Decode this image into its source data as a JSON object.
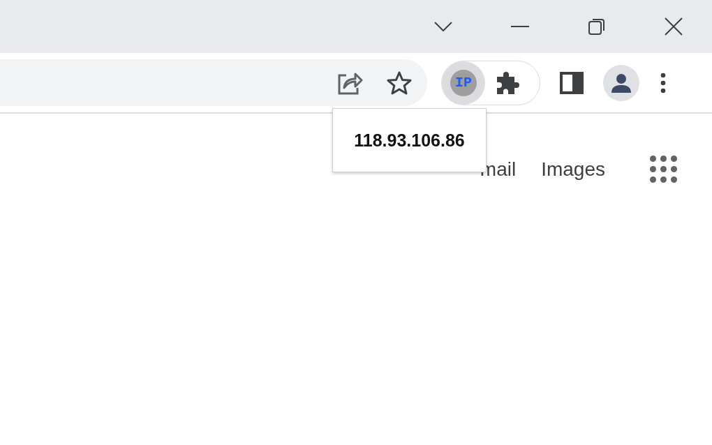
{
  "extension_button": {
    "badge": "IP",
    "pressed": true
  },
  "tooltip": "118.93.106.86",
  "header_links": [
    "mail",
    "Images"
  ]
}
